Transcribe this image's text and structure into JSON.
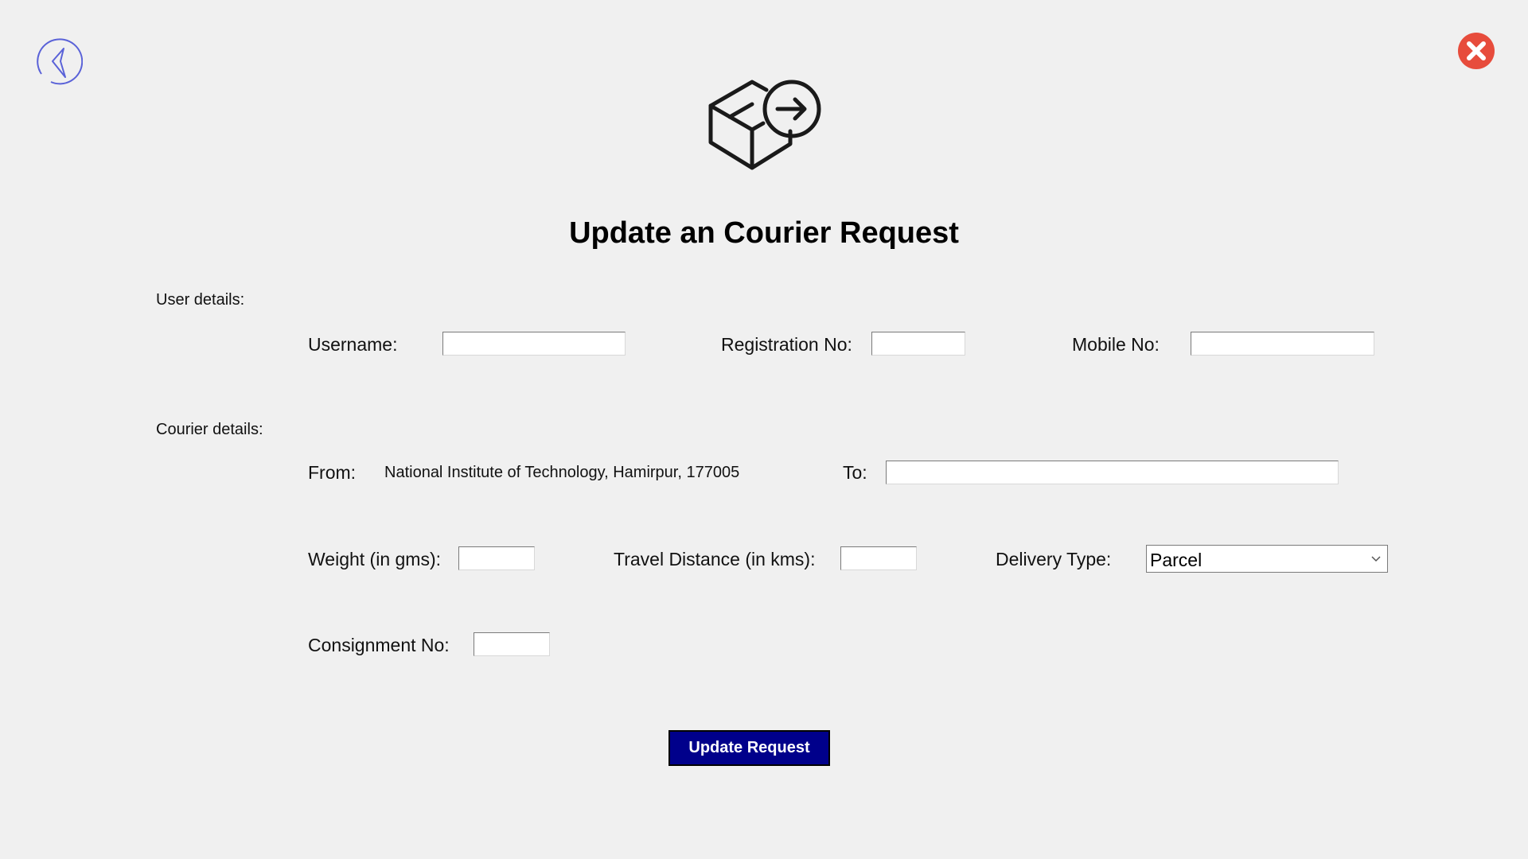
{
  "title": "Update an Courier Request",
  "icons": {
    "back": "back-arrow-circle-icon",
    "close": "close-circle-icon",
    "header": "package-send-icon"
  },
  "colors": {
    "back_icon": "#5a62d8",
    "close_icon": "#e74c3c",
    "button_bg": "#00008b"
  },
  "user_section": {
    "heading": "User details:",
    "username_label": "Username:",
    "username_value": "",
    "registration_label": "Registration No:",
    "registration_value": "",
    "mobile_label": "Mobile No:",
    "mobile_value": ""
  },
  "courier_section": {
    "heading": "Courier details:",
    "from_label": "From:",
    "from_value": "National Institute of Technology, Hamirpur, 177005",
    "to_label": "To:",
    "to_value": "",
    "weight_label": "Weight (in gms):",
    "weight_value": "",
    "distance_label": "Travel Distance (in kms):",
    "distance_value": "",
    "delivery_type_label": "Delivery Type:",
    "delivery_type_value": "Parcel",
    "consignment_label": "Consignment No:",
    "consignment_value": ""
  },
  "actions": {
    "update_label": "Update Request"
  }
}
